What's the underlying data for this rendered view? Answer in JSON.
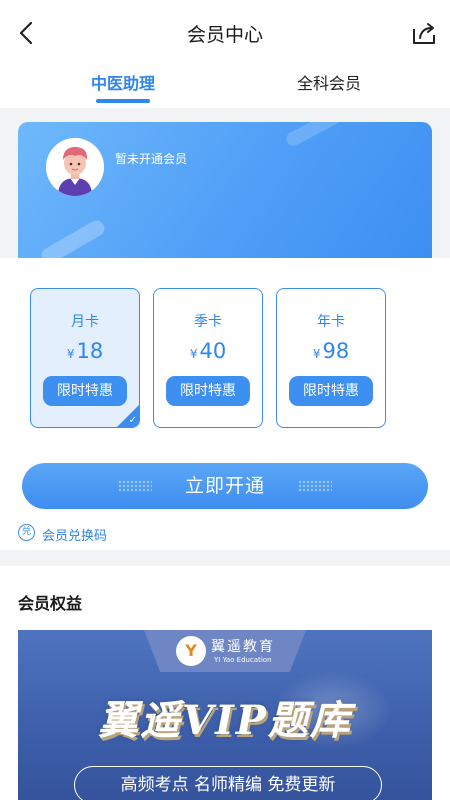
{
  "header": {
    "title": "会员中心",
    "back_icon": "chevron-left-icon",
    "share_icon": "share-icon"
  },
  "tabs": [
    {
      "label": "中医助理",
      "active": true
    },
    {
      "label": "全科会员",
      "active": false
    }
  ],
  "profile": {
    "status": "暂未开通会员",
    "avatar_icon": "avatar"
  },
  "plans": [
    {
      "name": "月卡",
      "currency": "¥",
      "price": "18",
      "button": "限时特惠",
      "selected": true
    },
    {
      "name": "季卡",
      "currency": "¥",
      "price": "40",
      "button": "限时特惠",
      "selected": false
    },
    {
      "name": "年卡",
      "currency": "¥",
      "price": "98",
      "button": "限时特惠",
      "selected": false
    }
  ],
  "open_button": "立即开通",
  "redeem": {
    "icon_text": "兑",
    "label": "会员兑换码"
  },
  "benefits": {
    "title": "会员权益",
    "banner": {
      "logo_mark": "Y",
      "logo_text": "翼遥教育",
      "logo_sub": "YI Yao Education",
      "title": "翼遥VIP题库",
      "tags": "高频考点  名师精编  免费更新"
    }
  },
  "colors": {
    "accent": "#2f86ec",
    "button": "#3d8ff1",
    "banner": "#3c5da9"
  }
}
